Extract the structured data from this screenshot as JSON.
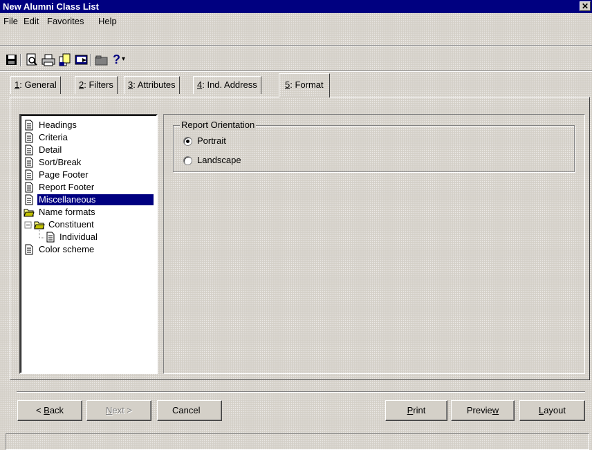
{
  "window": {
    "title": "New Alumni Class List",
    "close_glyph": "✕"
  },
  "menu": [
    "File",
    "Edit",
    "Favorites",
    "Help"
  ],
  "toolbar": {
    "icons": [
      "save-icon",
      "print-preview-icon",
      "print-icon",
      "export-icon",
      "send-icon",
      "folder-icon",
      "help-icon"
    ],
    "help_glyph": "?",
    "dropdown_glyph": "▾"
  },
  "tabs": [
    {
      "key": "1",
      "rest": ": General"
    },
    {
      "key": "2",
      "rest": ": Filters"
    },
    {
      "key": "3",
      "rest": ": Attributes"
    },
    {
      "key": "4",
      "rest": ": Ind. Address"
    },
    {
      "key": "5",
      "rest": ": Format",
      "active": true
    }
  ],
  "tree": {
    "items": [
      "Headings",
      "Criteria",
      "Detail",
      "Sort/Break",
      "Page Footer",
      "Report Footer",
      "Miscellaneous",
      "Name formats",
      "Constituent",
      "Individual",
      "Color scheme"
    ],
    "selected": "Miscellaneous"
  },
  "orientation": {
    "title": "Report Orientation",
    "options": [
      "Portrait",
      "Landscape"
    ],
    "selected": "Portrait"
  },
  "buttons": {
    "back": {
      "prefix": "< ",
      "key": "B",
      "rest": "ack"
    },
    "next": {
      "key": "N",
      "rest": "ext >"
    },
    "cancel": "Cancel",
    "print": {
      "key": "P",
      "rest": "rint"
    },
    "preview": {
      "pre": "Previe",
      "key": "w"
    },
    "layout": {
      "key": "L",
      "rest": "ayout"
    }
  },
  "colors": {
    "title_bar": "#000080",
    "face": "#d4d0c8",
    "selection": "#000080"
  }
}
